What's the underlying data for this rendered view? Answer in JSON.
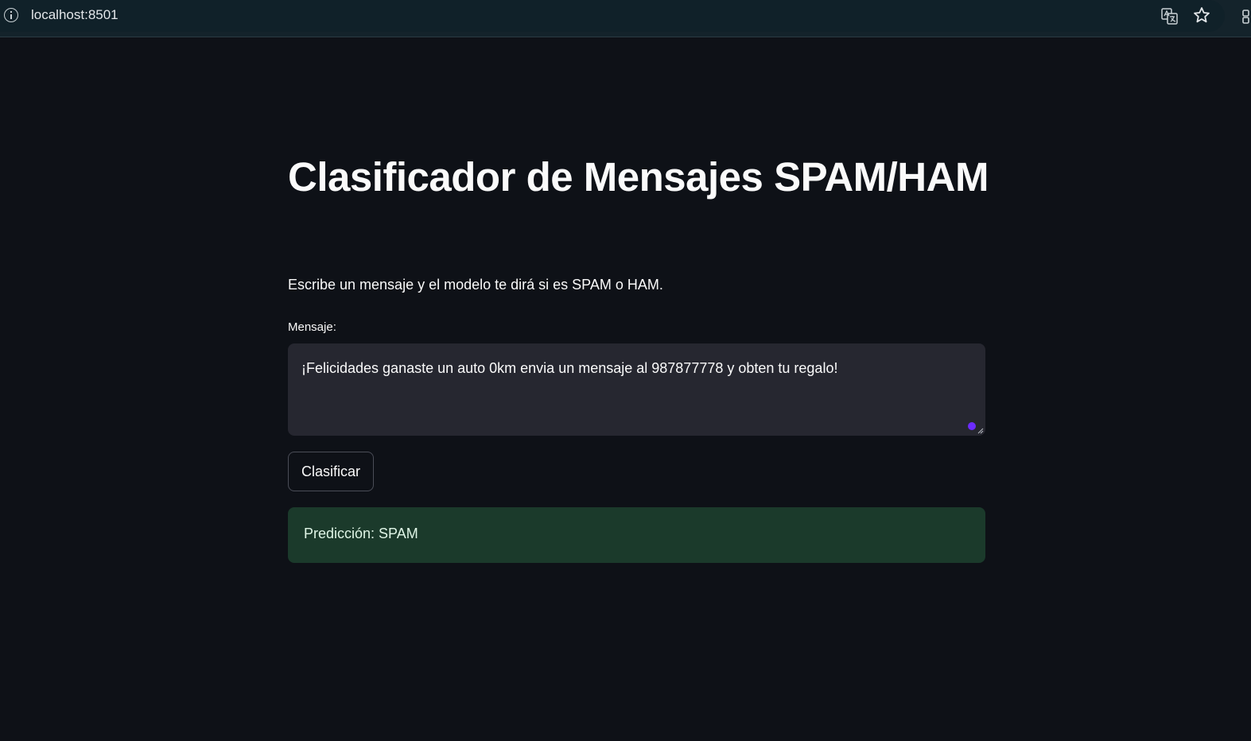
{
  "browser": {
    "url": "localhost:8501",
    "icons": [
      "info-icon",
      "translate-icon",
      "star-icon",
      "extensions-icon"
    ]
  },
  "app": {
    "title": "Clasificador de Mensajes SPAM/HAM",
    "description": "Escribe un mensaje y el modelo te dirá si es SPAM o HAM.",
    "message_label": "Mensaje:",
    "message_value": "¡Felicidades ganaste un auto 0km envia un mensaje al 987877778 y obten tu regalo!",
    "classify_button": "Clasificar",
    "result": "Predicción: SPAM"
  },
  "colors": {
    "background": "#0e1117",
    "input_background": "#262730",
    "success_background": "#1b3a2b",
    "accent": "#6c2bff"
  }
}
